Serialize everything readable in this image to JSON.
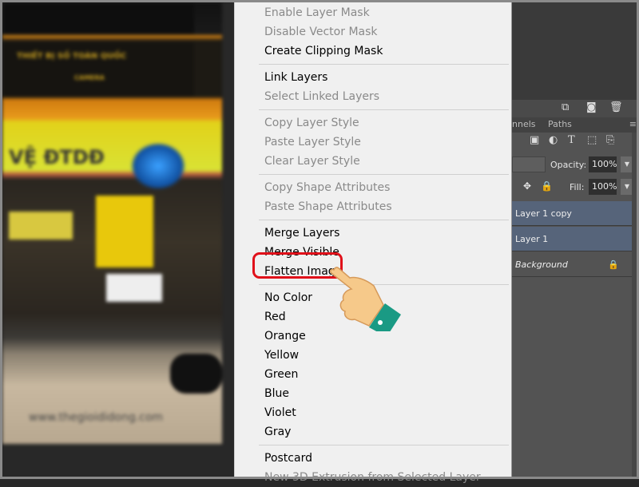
{
  "canvas": {
    "sign_text_1": "THIẾT BỊ SỐ TOÀN QUỐC",
    "sign_text_2": "CAMERA",
    "banner_text": "VỆ ĐTDĐ",
    "watermark": "www.thegioididong.com"
  },
  "context_menu": {
    "groups": [
      [
        {
          "label": "Enable Layer Mask",
          "enabled": false
        },
        {
          "label": "Disable Vector Mask",
          "enabled": false
        },
        {
          "label": "Create Clipping Mask",
          "enabled": true
        }
      ],
      [
        {
          "label": "Link Layers",
          "enabled": true
        },
        {
          "label": "Select Linked Layers",
          "enabled": false
        }
      ],
      [
        {
          "label": "Copy Layer Style",
          "enabled": false
        },
        {
          "label": "Paste Layer Style",
          "enabled": false
        },
        {
          "label": "Clear Layer Style",
          "enabled": false
        }
      ],
      [
        {
          "label": "Copy Shape Attributes",
          "enabled": false
        },
        {
          "label": "Paste Shape Attributes",
          "enabled": false
        }
      ],
      [
        {
          "label": "Merge Layers",
          "enabled": true
        },
        {
          "label": "Merge Visible",
          "enabled": true
        },
        {
          "label": "Flatten Image",
          "enabled": true,
          "highlighted": true
        }
      ],
      [
        {
          "label": "No Color",
          "enabled": true
        },
        {
          "label": "Red",
          "enabled": true
        },
        {
          "label": "Orange",
          "enabled": true
        },
        {
          "label": "Yellow",
          "enabled": true
        },
        {
          "label": "Green",
          "enabled": true
        },
        {
          "label": "Blue",
          "enabled": true
        },
        {
          "label": "Violet",
          "enabled": true
        },
        {
          "label": "Gray",
          "enabled": true
        }
      ],
      [
        {
          "label": "Postcard",
          "enabled": true
        },
        {
          "label": "New 3D Extrusion from Selected Layer",
          "enabled": false
        }
      ]
    ],
    "highlight_color": "#e0101a"
  },
  "layers_panel": {
    "tabs": [
      "nnels",
      "Paths"
    ],
    "opacity_label": "Opacity:",
    "opacity_value": "100%",
    "fill_label": "Fill:",
    "fill_value": "100%",
    "layers": [
      {
        "name": "Layer 1 copy",
        "selected": true
      },
      {
        "name": "Layer 1",
        "selected": true
      },
      {
        "name": "Background",
        "selected": false,
        "locked": true,
        "italic": true
      }
    ],
    "selected_color": "#56647a"
  }
}
